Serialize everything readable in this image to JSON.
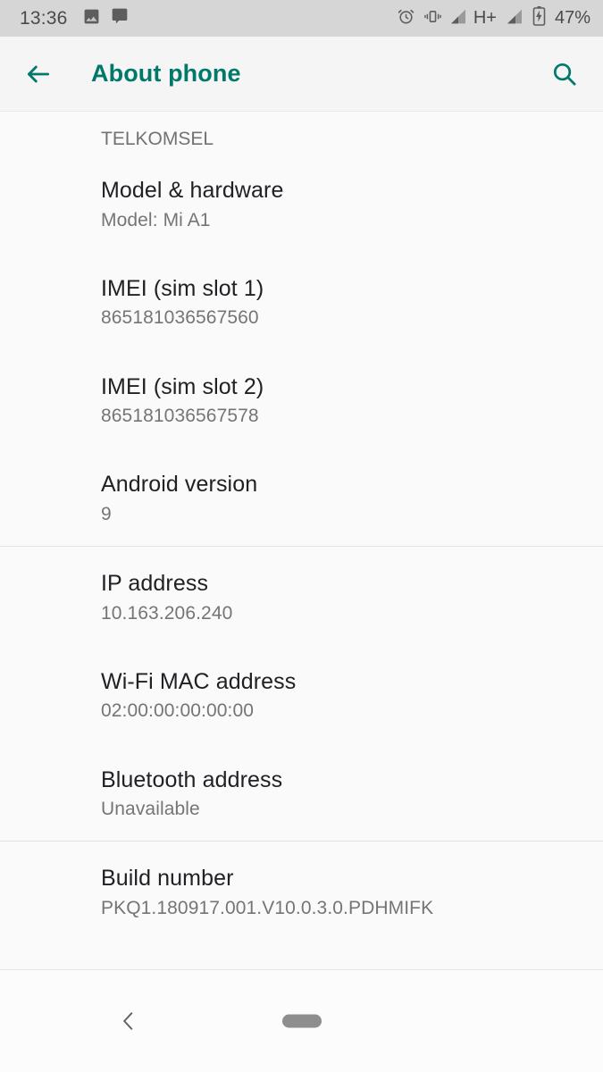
{
  "status_bar": {
    "time": "13:36",
    "battery_percent": "47%",
    "network_type": "H+",
    "icons": [
      "photo-icon",
      "chat-bubble-icon",
      "alarm-icon",
      "vibrate-icon",
      "signal-sim1-icon",
      "signal-sim2-icon",
      "battery-charging-icon"
    ],
    "background_color": "#d6d6d6"
  },
  "app_bar": {
    "title": "About phone",
    "back_label": "Back",
    "search_label": "Search",
    "accent_color": "#00796b"
  },
  "content": {
    "clipped_row": {
      "title": "",
      "subtitle": "TELKOMSEL"
    },
    "items": [
      {
        "title": "Model & hardware",
        "subtitle": "Model: Mi A1"
      },
      {
        "title": "IMEI (sim slot 1)",
        "subtitle": "865181036567560"
      },
      {
        "title": "IMEI (sim slot 2)",
        "subtitle": "865181036567578"
      },
      {
        "title": "Android version",
        "subtitle": "9"
      },
      {
        "title": "IP address",
        "subtitle": "10.163.206.240"
      },
      {
        "title": "Wi-Fi MAC address",
        "subtitle": "02:00:00:00:00:00"
      },
      {
        "title": "Bluetooth address",
        "subtitle": "Unavailable"
      },
      {
        "title": "Build number",
        "subtitle": "PKQ1.180917.001.V10.0.3.0.PDHMIFK"
      }
    ]
  },
  "nav_bar": {
    "back_label": "Back",
    "home_label": "Home"
  }
}
